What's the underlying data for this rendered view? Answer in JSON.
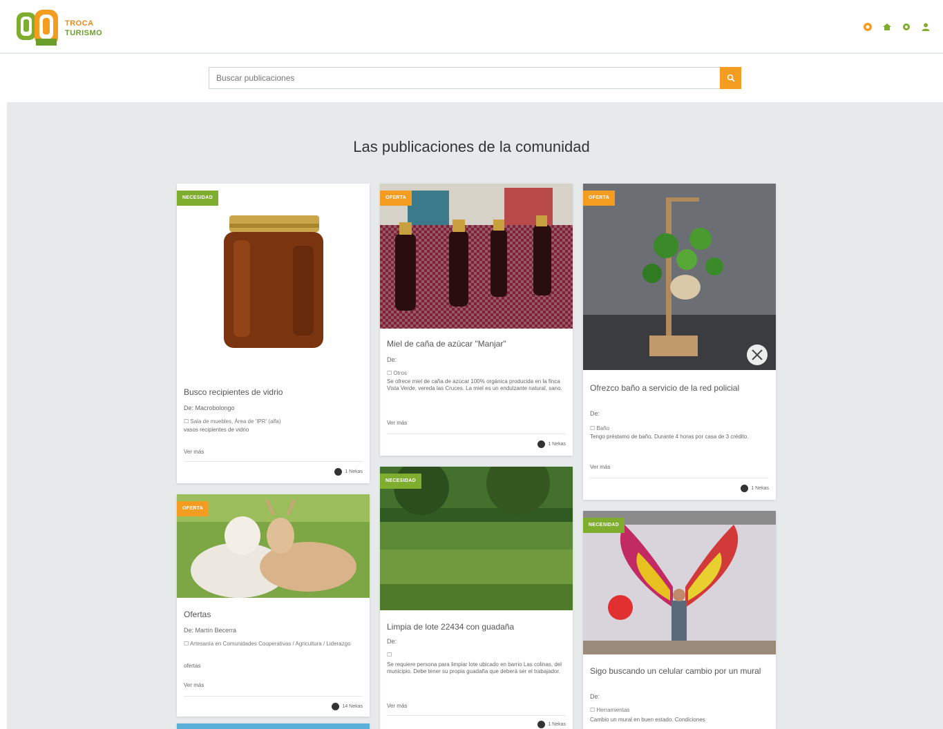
{
  "app": {
    "logo_line1": "TROCA",
    "logo_line2": "TURISMO",
    "accent_color": "#f39c1f",
    "green_color": "#7fad2e",
    "nav_icons": [
      "orange-circle-icon",
      "home-icon",
      "gear-icon",
      "user-icon"
    ]
  },
  "search": {
    "placeholder": "Buscar publicaciones",
    "button_icon": "search-icon"
  },
  "section": {
    "title": "Las publicaciones de la comunidad"
  },
  "cards": [
    {
      "badge": "NECESIDAD",
      "title": "Busco recipientes de vidrio",
      "author": "De: Macrobolongo",
      "category": "☐ Sala de muebles, Área de 'IPR' (alfa)",
      "description": "vasos recipientes de vidrio",
      "more": "Ver más",
      "likes": "1 Nekas"
    },
    {
      "badge": "OFERTA",
      "title": "Miel de caña de azúcar \"Manjar\"",
      "author": "De:",
      "category": "☐ Otros",
      "description": "Se ofrece miel de caña de azúcar 100% orgánica producida en la finca Vista Verde, vereda las Cruces. La miel es un endulzante natural, sano.",
      "more": "Ver más",
      "likes": "1 Nekas"
    },
    {
      "badge": "OFERTA",
      "title": "Ofrezco baño a servicio de la red policial",
      "author": "De:",
      "category": "☐ Baño",
      "description": "Tengo préstamo de baño. Durante 4 horas por casa de 3 crédito.",
      "more": "Ver más",
      "likes": "1 Nekas"
    },
    {
      "badge": "OFERTA",
      "title": "Ofertas",
      "author": "De: Martín Becerra",
      "category": "☐ Artesanía en Comunidades Cooperativas / Agricultura / Liderazgo",
      "description": "ofertas",
      "more": "Ver más",
      "likes": "14 Nekas"
    },
    {
      "badge": "NECESIDAD",
      "title": "Limpia de lote 22434 con guadaña",
      "author": "De:",
      "category": "☐",
      "description": "Se requiere persona para limpiar lote ubicado en barrio Las colinas, del municipio. Debe tener su propia guadaña que deberá ser el trabajador.",
      "more": "Ver más",
      "likes": "1 Nekas"
    },
    {
      "badge": "NECESIDAD",
      "title": "Sigo buscando un celular cambio por un mural",
      "author": "De:",
      "category": "☐ Herramientas",
      "description": "Cambio un mural en buen estado. Condiciones",
      "more": "",
      "likes": ""
    }
  ]
}
